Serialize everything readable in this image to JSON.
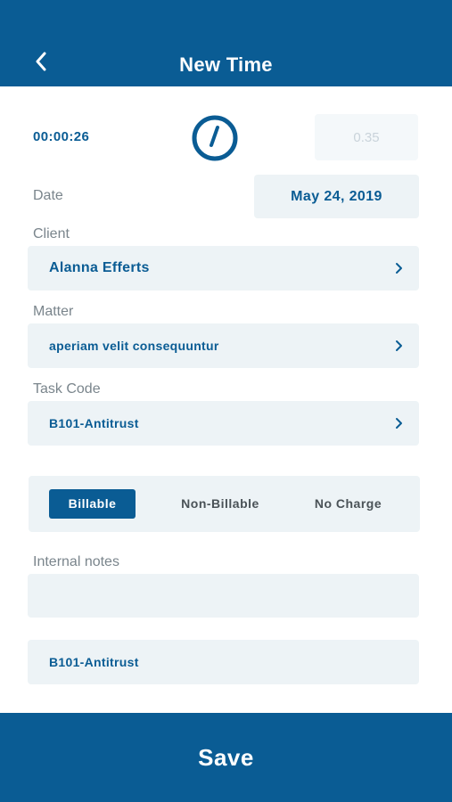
{
  "colors": {
    "primary": "#0a5c94",
    "field_bg": "#edf3f6",
    "label": "#7a858c",
    "inactive_text": "#4a5257",
    "placeholder_text": "#c9d3da"
  },
  "header": {
    "title": "New Time",
    "back_icon": "chevron-left-icon"
  },
  "timer": {
    "elapsed": "00:00:26",
    "icon": "stopwatch-icon",
    "hours": "0.35"
  },
  "date": {
    "label": "Date",
    "value": "May 24, 2019"
  },
  "client": {
    "label": "Client",
    "value": "Alanna Efferts",
    "icon": "chevron-right-icon"
  },
  "matter": {
    "label": "Matter",
    "value": "aperiam velit consequuntur",
    "icon": "chevron-right-icon"
  },
  "task_code": {
    "label": "Task Code",
    "value": "B101-Antitrust",
    "icon": "chevron-right-icon"
  },
  "billing": {
    "options": [
      "Billable",
      "Non-Billable",
      "No Charge"
    ],
    "selected": "Billable"
  },
  "internal_notes": {
    "label": "Internal notes",
    "value": ""
  },
  "activity": {
    "value": "B101-Antitrust"
  },
  "footer": {
    "save_label": "Save"
  }
}
